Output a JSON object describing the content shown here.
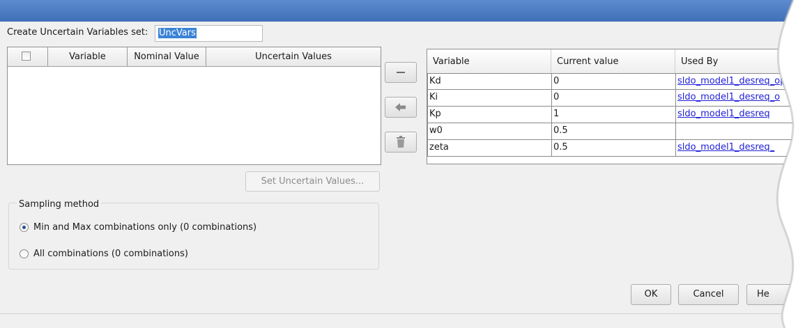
{
  "set_name": {
    "label": "Create Uncertain Variables set:",
    "value": "UncVars"
  },
  "uncertain_table": {
    "columns": [
      "Variable",
      "Nominal Value",
      "Uncertain Values"
    ],
    "rows": []
  },
  "side_buttons": [
    {
      "name": "remove",
      "icon": "minus-icon"
    },
    {
      "name": "move-left",
      "icon": "arrow-left-icon"
    },
    {
      "name": "delete",
      "icon": "trash-icon"
    }
  ],
  "variables_table": {
    "columns": [
      "Variable",
      "Current value",
      "Used By"
    ],
    "rows": [
      {
        "variable": "Kd",
        "current_value": "0",
        "used_by": "sldo_model1_desreq_op"
      },
      {
        "variable": "Ki",
        "current_value": "0",
        "used_by": "sldo_model1_desreq_o"
      },
      {
        "variable": "Kp",
        "current_value": "1",
        "used_by": "sldo_model1_desreq"
      },
      {
        "variable": "w0",
        "current_value": "0.5",
        "used_by": ""
      },
      {
        "variable": "zeta",
        "current_value": "0.5",
        "used_by": "sldo_model1_desreq_"
      }
    ]
  },
  "set_uncertain_values_label": "Set Uncertain Values...",
  "sampling": {
    "legend": "Sampling method",
    "options": [
      {
        "label": "Min and Max combinations only (0 combinations)",
        "checked": true
      },
      {
        "label": "All combinations (0 combinations)",
        "checked": false
      }
    ]
  },
  "buttons": {
    "ok": "OK",
    "cancel": "Cancel",
    "help": "He"
  },
  "colors": {
    "title_bar": "#4a7bc4",
    "link": "#2020d8",
    "selection": "#3b83d6"
  }
}
